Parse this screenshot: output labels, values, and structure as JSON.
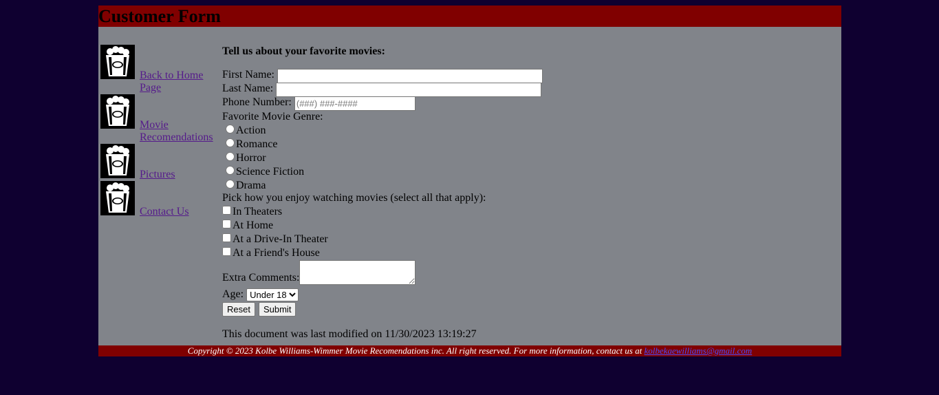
{
  "header": {
    "title": "Customer Form"
  },
  "nav": {
    "items": [
      {
        "label": "Back to Home Page",
        "icon": "popcorn-icon"
      },
      {
        "label": "Movie Recomendations",
        "icon": "popcorn-icon"
      },
      {
        "label": "Pictures",
        "icon": "popcorn-icon"
      },
      {
        "label": "Contact Us",
        "icon": "popcorn-icon"
      }
    ]
  },
  "form": {
    "lead": "Tell us about your favorite movies:",
    "first_name_label": "First Name:",
    "first_name_value": "",
    "last_name_label": "Last Name:",
    "last_name_value": "",
    "phone_label": "Phone Number:",
    "phone_placeholder": "(###) ###-####",
    "genre_label": "Favorite Movie Genre:",
    "genres": [
      "Action",
      "Romance",
      "Horror",
      "Science Fiction",
      "Drama"
    ],
    "watch_label": "Pick how you enjoy watching movies (select all that apply):",
    "watch_options": [
      "In Theaters",
      "At Home",
      "At a Drive-In Theater",
      "At a Friend's House"
    ],
    "comments_label": "Extra Comments:",
    "age_label": "Age:",
    "age_selected": "Under 18",
    "reset_label": "Reset",
    "submit_label": "Submit",
    "modified": "This document was last modified on 11/30/2023 13:19:27"
  },
  "footer": {
    "text": "Copyright © 2023 Kolbe Williams-Wimmer Movie Recomendations inc. All right reserved. For more information, contact us at",
    "email": "kolbekaewilliams@gmail.com"
  },
  "colors": {
    "page_bg": "#0f0030",
    "banner": "#800000",
    "content_bg": "#81848a",
    "link": "#551a8b"
  }
}
